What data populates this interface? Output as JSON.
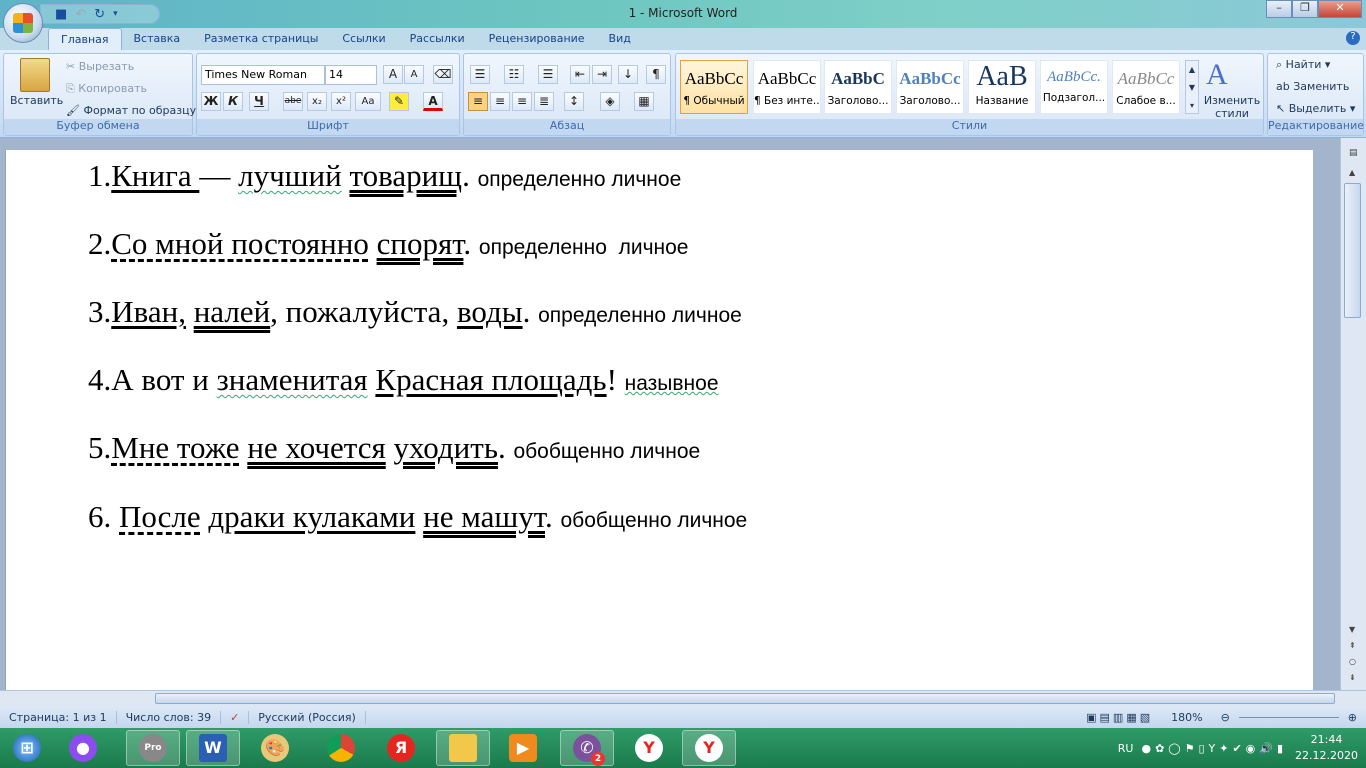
{
  "window": {
    "title": "1 - Microsoft Word"
  },
  "tabs": [
    "Главная",
    "Вставка",
    "Разметка страницы",
    "Ссылки",
    "Рассылки",
    "Рецензирование",
    "Вид"
  ],
  "clipboard": {
    "paste": "Вставить",
    "cut": "Вырезать",
    "copy": "Копировать",
    "format_painter": "Формат по образцу",
    "label": "Буфер обмена"
  },
  "font": {
    "name": "Times New Roman",
    "size": "14",
    "label": "Шрифт",
    "bold": "Ж",
    "italic": "К",
    "underline": "Ч",
    "strike": "abe",
    "sub": "x₂",
    "sup": "x²",
    "case": "Aa"
  },
  "paragraph": {
    "label": "Абзац"
  },
  "styles": {
    "label": "Стили",
    "items": [
      {
        "sample": "AaBbCc",
        "name": "¶ Обычный"
      },
      {
        "sample": "AaBbCc",
        "name": "¶ Без инте..."
      },
      {
        "sample": "AaBbC",
        "name": "Заголово..."
      },
      {
        "sample": "AaBbCc",
        "name": "Заголово..."
      },
      {
        "sample": "AaB",
        "name": "Название"
      },
      {
        "sample": "AaBbCc.",
        "name": "Подзагол..."
      },
      {
        "sample": "AaBbCc",
        "name": "Слабое в..."
      }
    ],
    "change": "Изменить стили"
  },
  "editing": {
    "label": "Редактирование",
    "find": "Найти",
    "replace": "Заменить",
    "select": "Выделить"
  },
  "document": {
    "lines": [
      {
        "segs": [
          {
            "t": "1.",
            "u": "none"
          },
          {
            "t": "Книга ",
            "u": "solid"
          },
          {
            "t": "— ",
            "u": "none"
          },
          {
            "t": "лучший",
            "u": "wavy"
          },
          {
            "t": " ",
            "u": "none"
          },
          {
            "t": "товарищ",
            "u": "double"
          },
          {
            "t": ". ",
            "u": "none"
          }
        ],
        "note": "определенно личное",
        "note_wavy": false
      },
      {
        "segs": [
          {
            "t": "2.",
            "u": "none"
          },
          {
            "t": "Со мной постоянно",
            "u": "dashed"
          },
          {
            "t": " ",
            "u": "none"
          },
          {
            "t": "спорят",
            "u": "double"
          },
          {
            "t": ". ",
            "u": "none"
          }
        ],
        "note": "определенно  личное",
        "note_wavy": false
      },
      {
        "segs": [
          {
            "t": "3.",
            "u": "none"
          },
          {
            "t": "Иван,",
            "u": "solid"
          },
          {
            "t": " ",
            "u": "none"
          },
          {
            "t": "налей",
            "u": "double"
          },
          {
            "t": ", пожалуйста, ",
            "u": "none"
          },
          {
            "t": "воды",
            "u": "solid"
          },
          {
            "t": ". ",
            "u": "none"
          }
        ],
        "note": "определенно личное",
        "note_wavy": false
      },
      {
        "segs": [
          {
            "t": "4.А вот и ",
            "u": "none"
          },
          {
            "t": "знаменитая",
            "u": "wavy"
          },
          {
            "t": " ",
            "u": "none"
          },
          {
            "t": "Красная площадь",
            "u": "solid"
          },
          {
            "t": "! ",
            "u": "none"
          }
        ],
        "note": "назывное",
        "note_wavy": true
      },
      {
        "segs": [
          {
            "t": "5.",
            "u": "none"
          },
          {
            "t": "Мне тоже",
            "u": "dashed"
          },
          {
            "t": " ",
            "u": "none"
          },
          {
            "t": "не хочется",
            "u": "double"
          },
          {
            "t": " ",
            "u": "none"
          },
          {
            "t": "уходить",
            "u": "double"
          },
          {
            "t": ". ",
            "u": "none"
          }
        ],
        "note": "обобщенно личное",
        "note_wavy": false
      },
      {
        "segs": [
          {
            "t": "6. ",
            "u": "none"
          },
          {
            "t": "После",
            "u": "dashed"
          },
          {
            "t": " ",
            "u": "none"
          },
          {
            "t": "драки кулаками",
            "u": "solid"
          },
          {
            "t": " ",
            "u": "none"
          },
          {
            "t": "не машут",
            "u": "double"
          },
          {
            "t": ". ",
            "u": "none"
          }
        ],
        "note": "обобщенно личное",
        "note_wavy": false
      }
    ]
  },
  "status": {
    "page": "Страница: 1 из 1",
    "words": "Число слов: 39",
    "lang": "Русский (Россия)",
    "zoom": "180%"
  },
  "taskbar": {
    "lang": "RU",
    "time": "21:44",
    "date": "22.12.2020",
    "viber_badge": "2",
    "yandex": "Я",
    "pro": "Pro"
  }
}
